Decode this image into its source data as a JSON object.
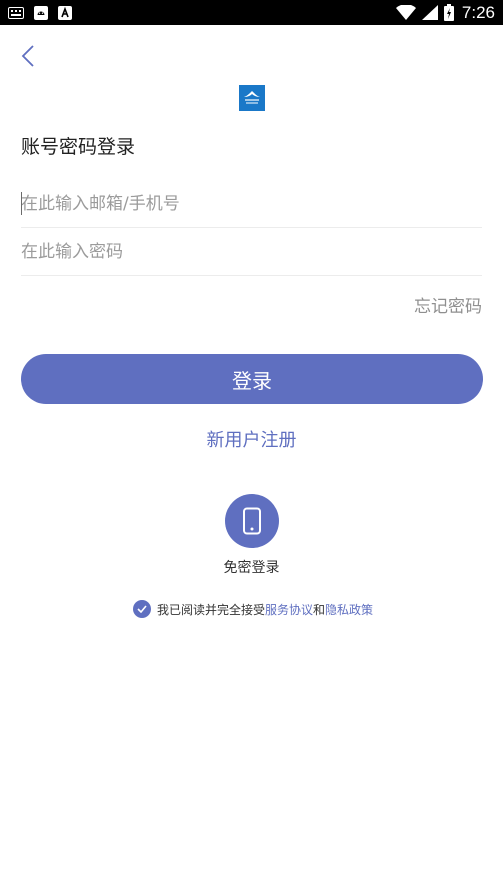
{
  "status_bar": {
    "time": "7:26",
    "left_icons": [
      "keyboard-icon",
      "android-notification-icon",
      "a-letter-icon"
    ],
    "right_icons": [
      "wifi-icon",
      "signal-icon",
      "battery-icon"
    ]
  },
  "header": {
    "back_icon": "chevron-left-icon",
    "logo_icon": "app-logo-icon"
  },
  "login": {
    "title": "账号密码登录",
    "email_placeholder": "在此输入邮箱/手机号",
    "password_placeholder": "在此输入密码",
    "forgot_label": "忘记密码",
    "login_label": "登录",
    "register_label": "新用户注册",
    "quick_login_label": "免密登录",
    "quick_login_icon": "phone-icon"
  },
  "agreement": {
    "prefix": "我已阅读并完全接受",
    "service_link": "服务协议",
    "conjunction": "和",
    "privacy_link": "隐私政策",
    "checked": true
  },
  "colors": {
    "accent": "#5f6fc0",
    "status_bar": "#000000",
    "placeholder": "#9b9b9b",
    "divider": "#ececec"
  }
}
